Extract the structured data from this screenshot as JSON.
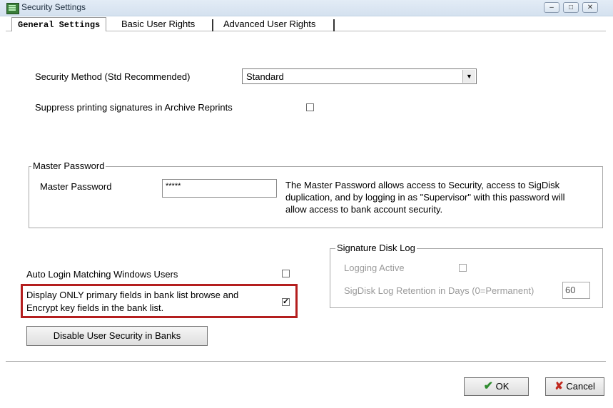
{
  "window": {
    "title": "Security Settings",
    "minimize": "–",
    "maximize": "□",
    "close": "✕"
  },
  "tabs": [
    {
      "label": "General Settings"
    },
    {
      "label": "Basic User Rights"
    },
    {
      "label": "Advanced User Rights"
    }
  ],
  "general": {
    "security_method_label": "Security Method (Std Recommended)",
    "security_method_value": "Standard",
    "suppress_label": "Suppress printing signatures in Archive Reprints",
    "suppress_checked": false
  },
  "master_password": {
    "group_title": "Master Password",
    "field_label": "Master Password",
    "field_value": "*****",
    "description": "The Master Password allows access to Security, access to SigDisk duplication, and by logging in as \"Supervisor\" with this password will allow access to bank account security."
  },
  "auto_login": {
    "label": "Auto Login Matching Windows Users",
    "checked": false
  },
  "display_only": {
    "label_line1": "Display ONLY primary fields in bank list browse and",
    "label_line2": "Encrypt key fields in the bank list.",
    "check_mark": "✓"
  },
  "disable_button_label": "Disable User Security in Banks",
  "sigdisk_log": {
    "group_title": "Signature Disk Log",
    "logging_active_label": "Logging Active",
    "retention_label": "SigDisk Log Retention in Days (0=Permanent)",
    "retention_value": "60"
  },
  "footer": {
    "ok_label": "OK",
    "cancel_label": "Cancel",
    "ok_icon": "✔",
    "cancel_icon": "✘"
  },
  "colors": {
    "highlight": "#b41e1e",
    "ok_green": "#2e8b2e",
    "cancel_red": "#c0281e"
  }
}
